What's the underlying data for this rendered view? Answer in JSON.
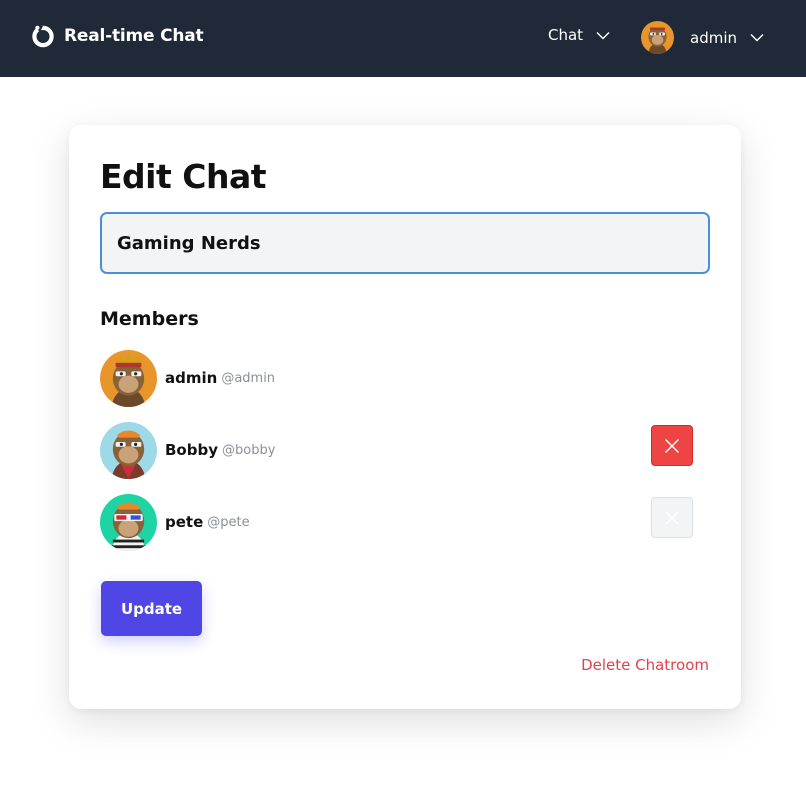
{
  "navbar": {
    "brand": "Real-time Chat",
    "chat_menu_label": "Chat",
    "user_name": "admin"
  },
  "page": {
    "title": "Edit Chat"
  },
  "form": {
    "chat_name_value": "Gaming Nerds",
    "members_heading": "Members",
    "members": [
      {
        "name": "admin",
        "handle": "@admin",
        "avatar": "ape-orange-crown-avatar",
        "removable": false
      },
      {
        "name": "Bobby",
        "handle": "@bobby",
        "avatar": "ape-lightblue-avatar",
        "removable": true,
        "remove_state": "active"
      },
      {
        "name": "pete",
        "handle": "@pete",
        "avatar": "ape-teal-3d-glasses-avatar",
        "removable": true,
        "remove_state": "inactive"
      }
    ],
    "update_label": "Update",
    "delete_label": "Delete Chatroom"
  },
  "colors": {
    "navbar": "#1f2937",
    "primary_button": "#4f46e5",
    "danger": "#ef4444",
    "delete_link": "#e3424d",
    "input_focus_border": "#4a90d9"
  },
  "icons": {
    "brand": "ring-logo-icon",
    "dropdown": "chevron-down-icon",
    "remove": "close-icon"
  }
}
